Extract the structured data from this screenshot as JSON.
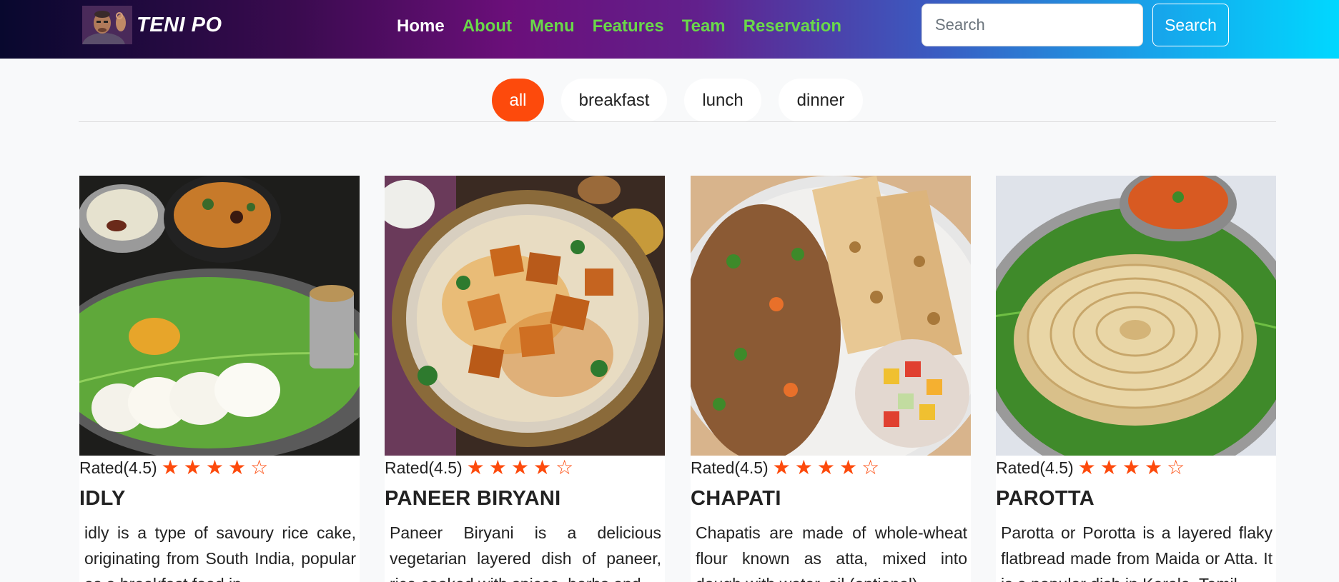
{
  "brand": {
    "name": "TENI PO"
  },
  "nav": {
    "links": [
      "Home",
      "About",
      "Menu",
      "Features",
      "Team",
      "Reservation"
    ]
  },
  "search": {
    "placeholder": "Search",
    "button_label": "Search"
  },
  "filters": [
    "all",
    "breakfast",
    "lunch",
    "dinner"
  ],
  "colors": {
    "accent": "#fd4a0c",
    "nav_link": "#6ad84a"
  },
  "cards": [
    {
      "rating_label": "Rated(4.5)",
      "rating": 4.5,
      "title": "IDLY",
      "description": "idly is a type of savoury rice cake, originating from South India, popular as a breakfast food in"
    },
    {
      "rating_label": "Rated(4.5)",
      "rating": 4.5,
      "title": "PANEER BIRYANI",
      "description": "Paneer Biryani is a delicious vegetarian layered dish of paneer, rice cooked with spices, herbs and"
    },
    {
      "rating_label": "Rated(4.5)",
      "rating": 4.5,
      "title": "CHAPATI",
      "description": "Chapatis are made of whole-wheat flour known as atta, mixed into dough with water, oil (optional)"
    },
    {
      "rating_label": "Rated(4.5)",
      "rating": 4.5,
      "title": "PAROTTA",
      "description": "Parotta or Porotta is a layered flaky flatbread made from Maida or Atta. It is a popular dish in Kerala, Tamil"
    }
  ]
}
